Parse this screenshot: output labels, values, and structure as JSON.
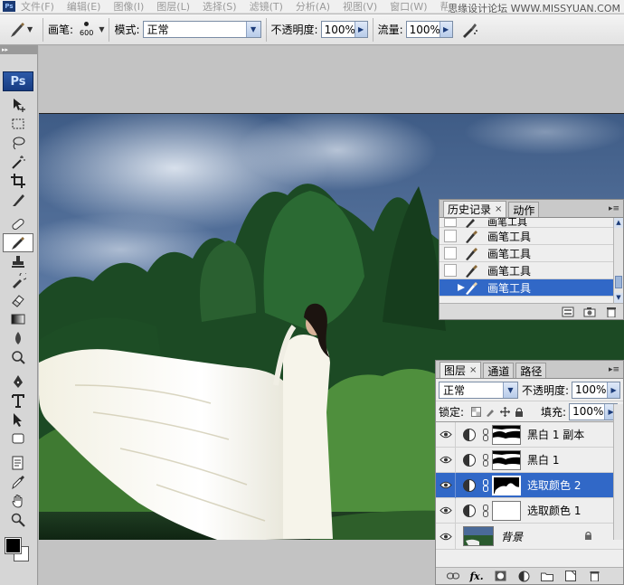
{
  "menubar": {
    "items": [
      "文件(F)",
      "编辑(E)",
      "图像(I)",
      "图层(L)",
      "选择(S)",
      "滤镜(T)",
      "分析(A)",
      "视图(V)",
      "窗口(W)",
      "帮助(H)"
    ],
    "watermark": "思缘设计论坛  WWW.MISSYUAN.COM",
    "logo": "Ps"
  },
  "options": {
    "brush_label": "画笔:",
    "brush_size": "600",
    "mode_label": "模式:",
    "mode_value": "正常",
    "opacity_label": "不透明度:",
    "opacity_value": "100%",
    "flow_label": "流量:",
    "flow_value": "100%"
  },
  "toolbox": {
    "logo": "Ps",
    "tools": [
      "move-icon",
      "marquee-icon",
      "lasso-icon",
      "magic-wand-icon",
      "crop-icon",
      "slice-icon",
      "healing-brush-icon",
      "brush-icon",
      "clone-stamp-icon",
      "history-brush-icon",
      "eraser-icon",
      "gradient-icon",
      "blur-icon",
      "dodge-icon",
      "pen-icon",
      "type-icon",
      "path-selection-icon",
      "shape-icon",
      "notes-icon",
      "eyedropper-icon",
      "hand-icon",
      "zoom-icon"
    ],
    "active_tool": "brush-icon",
    "foreground_color": "#000000",
    "background_color": "#ffffff"
  },
  "history": {
    "tabs": [
      "历史记录",
      "动作"
    ],
    "close_symbol": "×",
    "items": [
      "画笔工具",
      "画笔工具",
      "画笔工具",
      "画笔工具",
      "画笔工具"
    ],
    "selected_index": 4
  },
  "layers": {
    "tabs": [
      "图层",
      "通道",
      "路径"
    ],
    "close_symbol": "×",
    "blend_mode": "正常",
    "opacity_label": "不透明度:",
    "opacity_value": "100%",
    "lock_label": "锁定:",
    "fill_label": "填充:",
    "fill_value": "100%",
    "items": [
      {
        "name": "黑白 1 副本",
        "type": "adjustment"
      },
      {
        "name": "黑白 1",
        "type": "adjustment"
      },
      {
        "name": "选取颜色 2",
        "type": "adjustment"
      },
      {
        "name": "选取颜色 1",
        "type": "adjustment"
      },
      {
        "name": "背景",
        "type": "background"
      }
    ],
    "selected_index": 2,
    "footer_icons": [
      "link-layers-icon",
      "fx-icon",
      "add-mask-icon",
      "adjustment-layer-icon",
      "group-icon",
      "new-layer-icon",
      "trash-icon"
    ],
    "footer_fx": "fx."
  },
  "colors": {
    "selection": "#3168c7",
    "panel_bg": "#eeeeee",
    "workspace_bg": "#c3c3c3"
  }
}
